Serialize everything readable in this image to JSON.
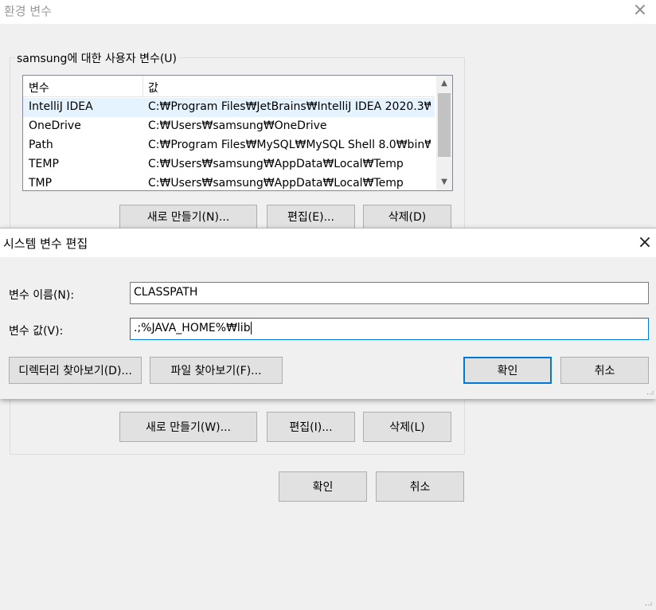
{
  "env_window": {
    "title": "환경 변수",
    "close_icon": "×",
    "user_group_label": "samsung에 대한 사용자 변수(U)",
    "columns": [
      "변수",
      "값"
    ],
    "rows": [
      {
        "name": "IntelliJ IDEA",
        "value": "C:₩Program Files₩JetBrains₩IntelliJ IDEA 2020.3₩..."
      },
      {
        "name": "OneDrive",
        "value": "C:₩Users₩samsung₩OneDrive"
      },
      {
        "name": "Path",
        "value": "C:₩Program Files₩MySQL₩MySQL Shell 8.0₩bin₩;..."
      },
      {
        "name": "TEMP",
        "value": "C:₩Users₩samsung₩AppData₩Local₩Temp"
      },
      {
        "name": "TMP",
        "value": "C:₩Users₩samsung₩AppData₩Local₩Temp"
      }
    ],
    "user_buttons": {
      "new": "새로 만들기(N)...",
      "edit": "편집(E)...",
      "delete": "삭제(D)"
    },
    "system_buttons": {
      "new": "새로 만들기(W)...",
      "edit": "편집(I)...",
      "delete": "삭제(L)"
    },
    "ok": "확인",
    "cancel": "취소"
  },
  "edit_dialog": {
    "title": "시스템 변수 편집",
    "close_icon": "×",
    "name_label": "변수 이름(N):",
    "name_value": "CLASSPATH",
    "value_label": "변수 값(V):",
    "value_value": ".;%JAVA_HOME%₩lib",
    "browse_dir": "디렉터리 찾아보기(D)...",
    "browse_file": "파일 찾아보기(F)...",
    "ok": "확인",
    "cancel": "취소"
  },
  "colors": {
    "accent": "#0078d7",
    "selected_row": "#e5f3ff"
  }
}
